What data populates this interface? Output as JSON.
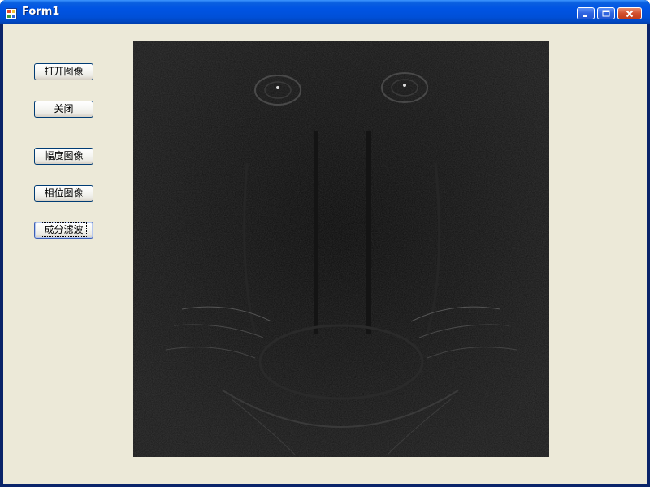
{
  "window": {
    "title": "Form1",
    "controls": {
      "minimize": "minimize",
      "maximize": "maximize",
      "close": "close"
    }
  },
  "buttons": {
    "open_image": "打开图像",
    "close": "关闭",
    "amplitude_image": "幅度图像",
    "phase_image": "相位图像",
    "component_filter": "成分滤波"
  },
  "picture": {
    "content": "filtered grayscale image (mandrill edge response)"
  },
  "colors": {
    "title_bar": "#0054e3",
    "client_background": "#ece9d8",
    "picture_background": "#060606",
    "close_button": "#c23d1c"
  }
}
